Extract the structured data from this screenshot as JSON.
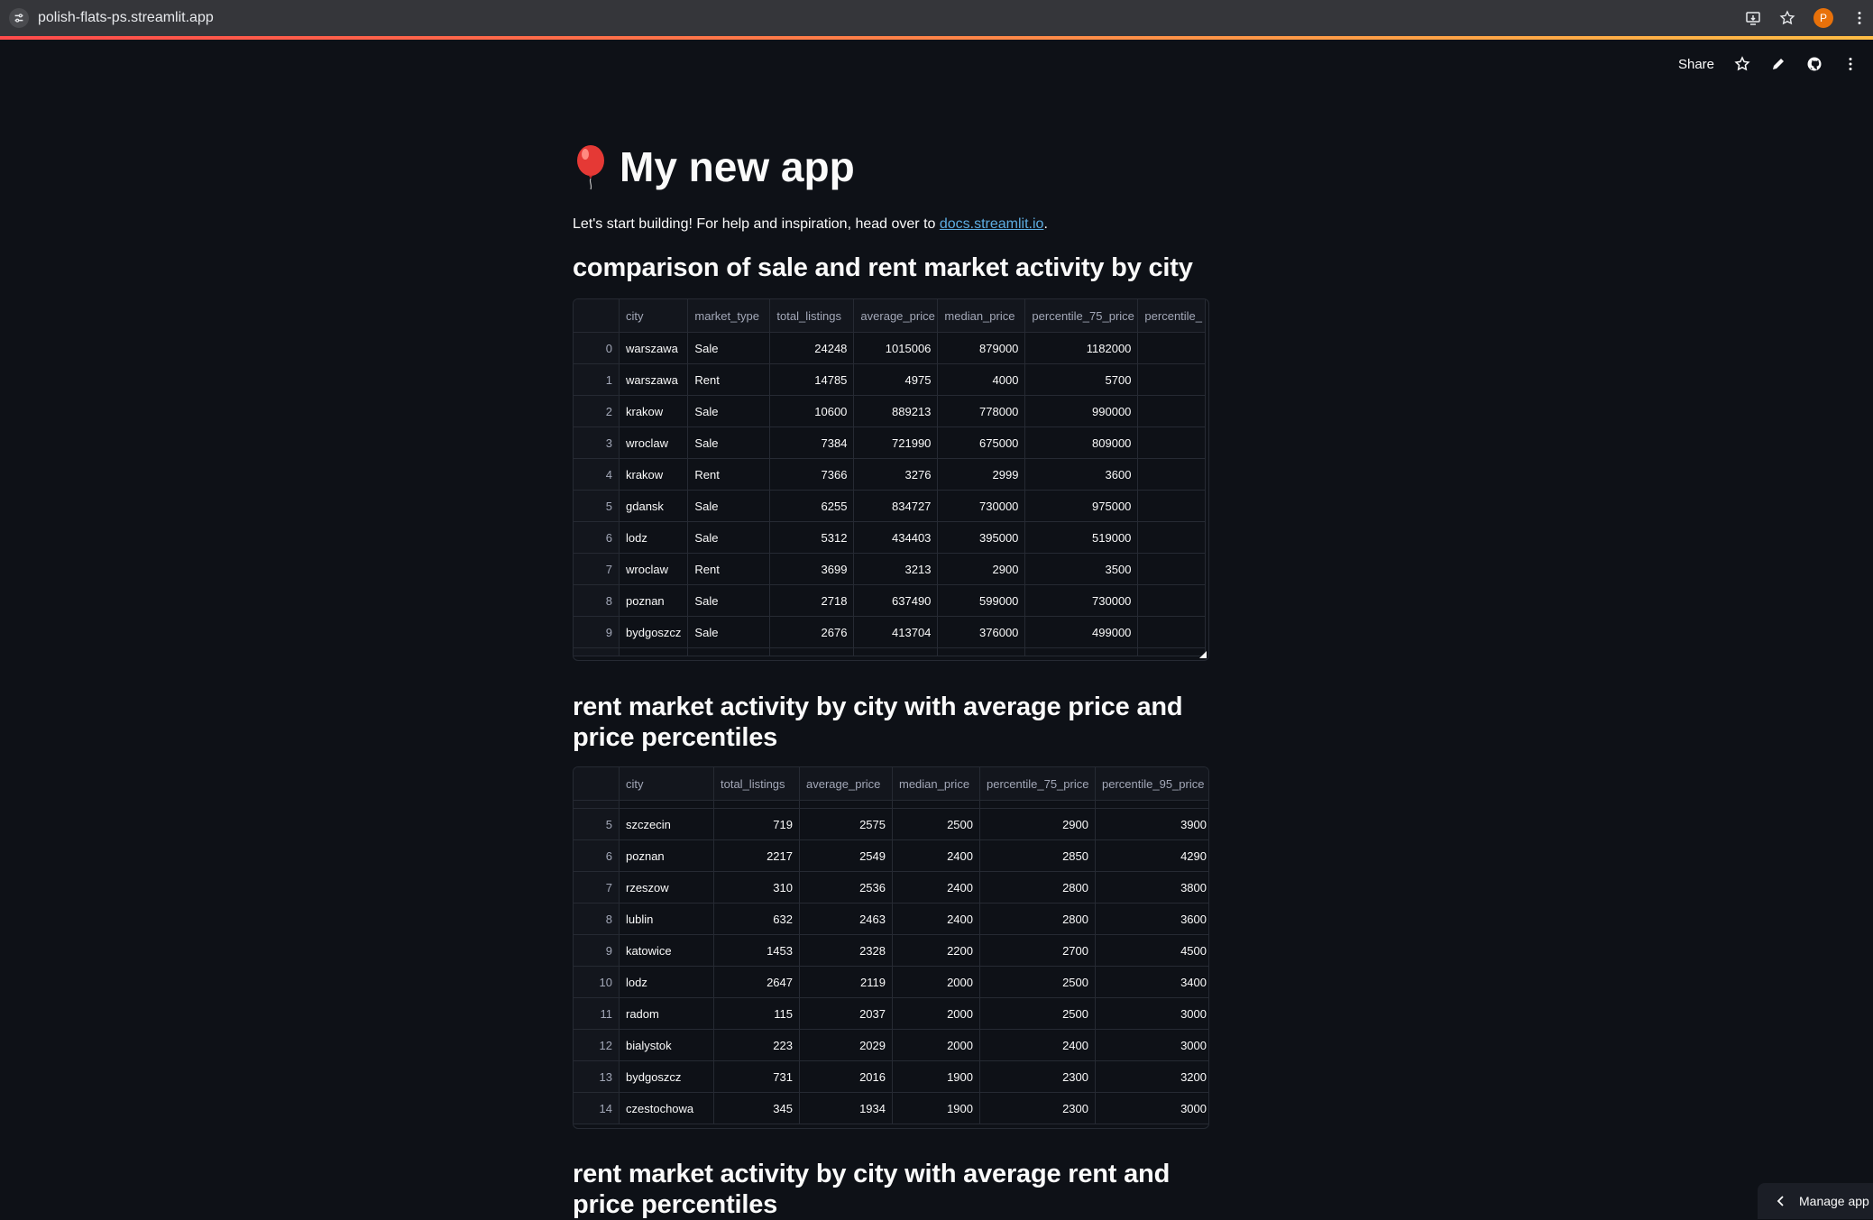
{
  "browser": {
    "url": "polish-flats-ps.streamlit.app",
    "profile_initial": "P"
  },
  "header": {
    "share_label": "Share"
  },
  "app": {
    "title": "My new app",
    "intro_text": "Let's start building! For help and inspiration, head over to ",
    "intro_link": "docs.streamlit.io",
    "intro_end": "."
  },
  "sections": {
    "s1": "comparison of sale and rent market activity by city",
    "s2": "rent market activity by city with average price and price percentiles",
    "s3": "rent market activity by city with average rent and price percentiles"
  },
  "table1": {
    "columns": [
      "",
      "city",
      "market_type",
      "total_listings",
      "average_price",
      "median_price",
      "percentile_75_price",
      "percentile_"
    ],
    "rows": [
      [
        "0",
        "warszawa",
        "Sale",
        "24248",
        "1015006",
        "879000",
        "1182000"
      ],
      [
        "1",
        "warszawa",
        "Rent",
        "14785",
        "4975",
        "4000",
        "5700"
      ],
      [
        "2",
        "krakow",
        "Sale",
        "10600",
        "889213",
        "778000",
        "990000"
      ],
      [
        "3",
        "wroclaw",
        "Sale",
        "7384",
        "721990",
        "675000",
        "809000"
      ],
      [
        "4",
        "krakow",
        "Rent",
        "7366",
        "3276",
        "2999",
        "3600"
      ],
      [
        "5",
        "gdansk",
        "Sale",
        "6255",
        "834727",
        "730000",
        "975000"
      ],
      [
        "6",
        "lodz",
        "Sale",
        "5312",
        "434403",
        "395000",
        "519000"
      ],
      [
        "7",
        "wroclaw",
        "Rent",
        "3699",
        "3213",
        "2900",
        "3500"
      ],
      [
        "8",
        "poznan",
        "Sale",
        "2718",
        "637490",
        "599000",
        "730000"
      ],
      [
        "9",
        "bydgoszcz",
        "Sale",
        "2676",
        "413704",
        "376000",
        "499000"
      ]
    ]
  },
  "table2": {
    "columns": [
      "",
      "city",
      "total_listings",
      "average_price",
      "median_price",
      "percentile_75_price",
      "percentile_95_price"
    ],
    "rows": [
      [
        "5",
        "szczecin",
        "719",
        "2575",
        "2500",
        "2900",
        "3900"
      ],
      [
        "6",
        "poznan",
        "2217",
        "2549",
        "2400",
        "2850",
        "4290"
      ],
      [
        "7",
        "rzeszow",
        "310",
        "2536",
        "2400",
        "2800",
        "3800"
      ],
      [
        "8",
        "lublin",
        "632",
        "2463",
        "2400",
        "2800",
        "3600"
      ],
      [
        "9",
        "katowice",
        "1453",
        "2328",
        "2200",
        "2700",
        "4500"
      ],
      [
        "10",
        "lodz",
        "2647",
        "2119",
        "2000",
        "2500",
        "3400"
      ],
      [
        "11",
        "radom",
        "115",
        "2037",
        "2000",
        "2500",
        "3000"
      ],
      [
        "12",
        "bialystok",
        "223",
        "2029",
        "2000",
        "2400",
        "3000"
      ],
      [
        "13",
        "bydgoszcz",
        "731",
        "2016",
        "1900",
        "2300",
        "3200"
      ],
      [
        "14",
        "czestochowa",
        "345",
        "1934",
        "1900",
        "2300",
        "3000"
      ]
    ]
  },
  "manage_app": {
    "label": "Manage app"
  },
  "colors": {
    "background": "#0e1117",
    "link": "#5dade2",
    "border": "#262a33",
    "accent_gradient_start": "#ff4b4b",
    "accent_gradient_end": "#ffbd45"
  },
  "icons": [
    "site-settings-icon",
    "install-icon",
    "bookmark-star-icon",
    "kebab-menu-icon",
    "star-icon",
    "edit-pencil-icon",
    "github-icon",
    "balloon-icon",
    "chevron-left-icon"
  ]
}
